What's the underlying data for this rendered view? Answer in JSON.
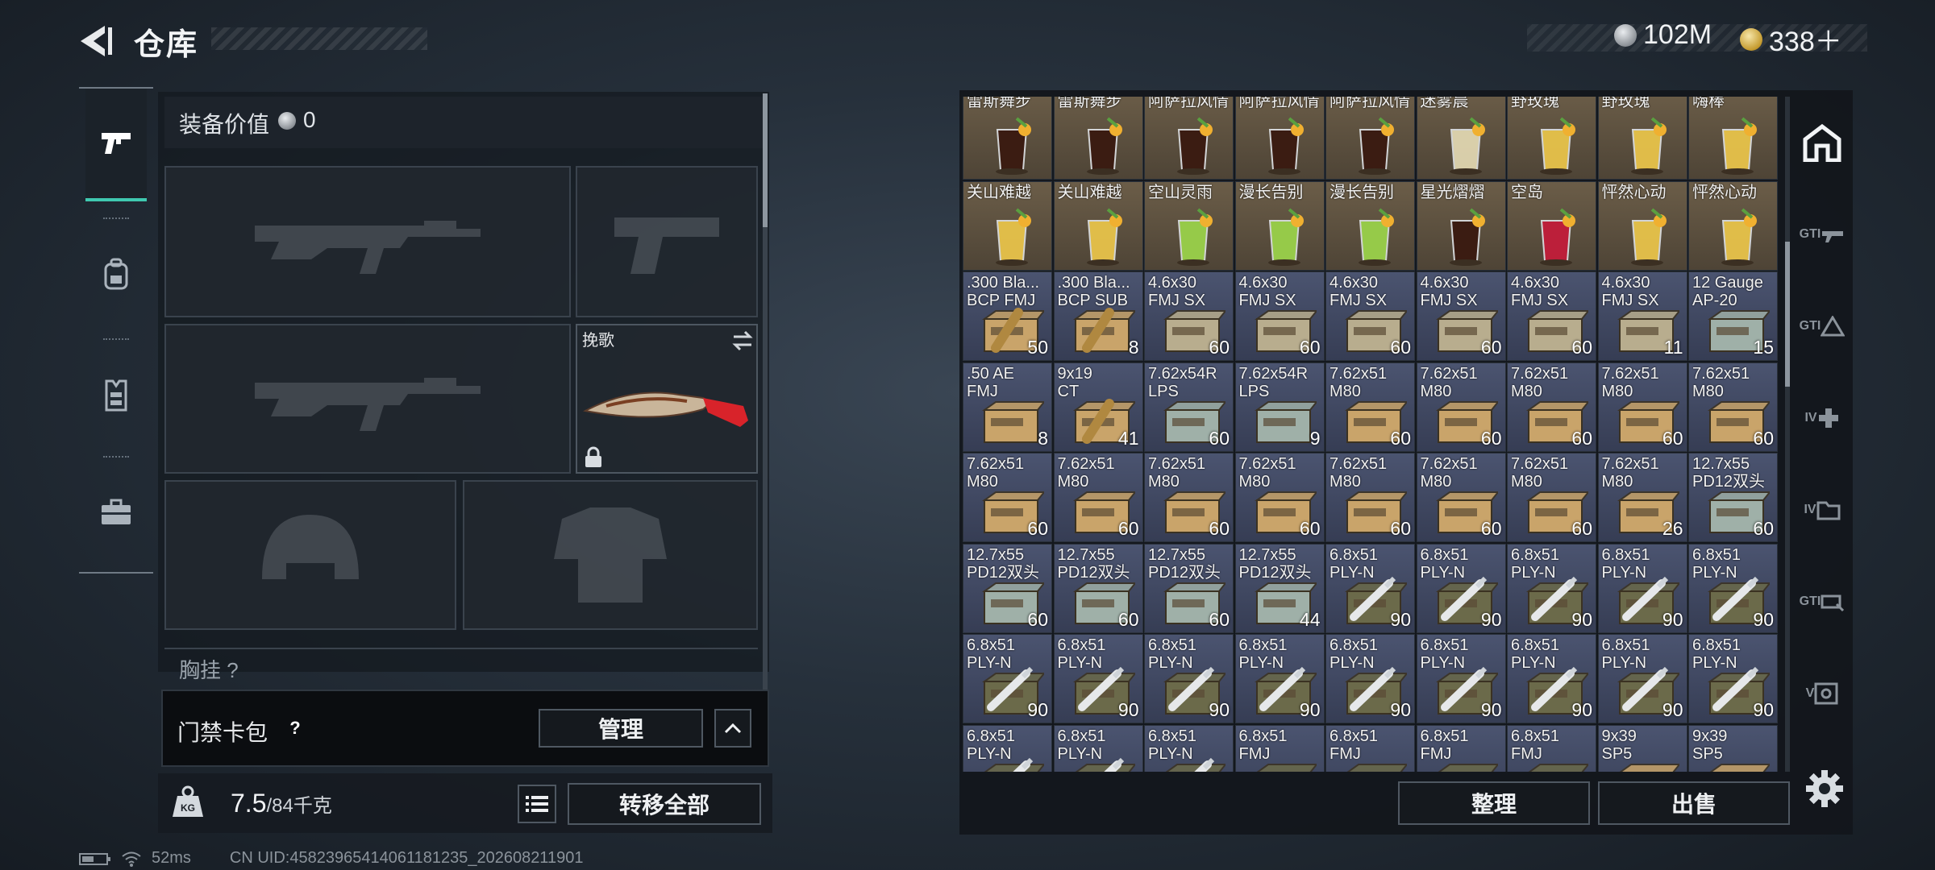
{
  "header": {
    "title": "仓库",
    "currency": [
      {
        "icon": "silver-coin-icon",
        "value": "102M"
      },
      {
        "icon": "gold-coin-icon",
        "value": "338＋"
      }
    ]
  },
  "left_nav": {
    "items": [
      {
        "name": "weapons",
        "icon": "pistol-icon",
        "active": true
      },
      {
        "name": "backpack",
        "icon": "backpack-icon",
        "active": false
      },
      {
        "name": "vest",
        "icon": "vest-icon",
        "active": false
      },
      {
        "name": "case",
        "icon": "briefcase-icon",
        "active": false
      }
    ]
  },
  "loadout": {
    "equip_value_label": "装备价值",
    "equip_value": "0",
    "secondary_slot_item": "挽歌",
    "chest_label": "胸挂 ?",
    "access_card_label": "门禁卡包",
    "access_help": "?",
    "manage_label": "管理",
    "weight_value": "7.5",
    "weight_cap": "/84千克",
    "weight_icon_text": "KG",
    "transfer_all_label": "转移全部"
  },
  "status": {
    "ping": "52ms",
    "uid": "CN UID:4582396541406118123​5_202608211901"
  },
  "inventory": {
    "cells": [
      [
        "雷斯舞步",
        "",
        "drink"
      ],
      [
        "雷斯舞步",
        "",
        "drink"
      ],
      [
        "阿萨拉风情",
        "",
        "drink"
      ],
      [
        "阿萨拉风情",
        "",
        "drink"
      ],
      [
        "阿萨拉风情",
        "",
        "drink"
      ],
      [
        "迷雾晨",
        "",
        "drink"
      ],
      [
        "野玫瑰",
        "",
        "drink"
      ],
      [
        "野玫瑰",
        "",
        "drink"
      ],
      [
        "嗨棒",
        "",
        "drink"
      ],
      [
        "关山难越",
        "",
        "drink"
      ],
      [
        "关山难越",
        "",
        "drink"
      ],
      [
        "空山灵雨",
        "",
        "drink"
      ],
      [
        "漫长告别",
        "",
        "drink"
      ],
      [
        "漫长告别",
        "",
        "drink"
      ],
      [
        "星光熠熠",
        "",
        "drink"
      ],
      [
        "空岛",
        "",
        "drink"
      ],
      [
        "怦然心动",
        "",
        "drink"
      ],
      [
        "怦然心动",
        "",
        "drink"
      ],
      [
        ".300 Bla...\nBCP FMJ",
        "50",
        "ammo"
      ],
      [
        ".300 Bla...\nBCP SUB",
        "8",
        "ammo"
      ],
      [
        "4.6x30\nFMJ SX",
        "60",
        "ammo"
      ],
      [
        "4.6x30\nFMJ SX",
        "60",
        "ammo"
      ],
      [
        "4.6x30\nFMJ SX",
        "60",
        "ammo"
      ],
      [
        "4.6x30\nFMJ SX",
        "60",
        "ammo"
      ],
      [
        "4.6x30\nFMJ SX",
        "60",
        "ammo"
      ],
      [
        "4.6x30\nFMJ SX",
        "11",
        "ammo"
      ],
      [
        "12 Gauge\nAP-20",
        "15",
        "ammo"
      ],
      [
        ".50 AE\nFMJ",
        "8",
        "ammo"
      ],
      [
        "9x19\nCT",
        "41",
        "ammo"
      ],
      [
        "7.62x54R\nLPS",
        "60",
        "ammo"
      ],
      [
        "7.62x54R\nLPS",
        "9",
        "ammo"
      ],
      [
        "7.62x51\nM80",
        "60",
        "ammo"
      ],
      [
        "7.62x51\nM80",
        "60",
        "ammo"
      ],
      [
        "7.62x51\nM80",
        "60",
        "ammo"
      ],
      [
        "7.62x51\nM80",
        "60",
        "ammo"
      ],
      [
        "7.62x51\nM80",
        "60",
        "ammo"
      ],
      [
        "7.62x51\nM80",
        "60",
        "ammo"
      ],
      [
        "7.62x51\nM80",
        "60",
        "ammo"
      ],
      [
        "7.62x51\nM80",
        "60",
        "ammo"
      ],
      [
        "7.62x51\nM80",
        "60",
        "ammo"
      ],
      [
        "7.62x51\nM80",
        "60",
        "ammo"
      ],
      [
        "7.62x51\nM80",
        "60",
        "ammo"
      ],
      [
        "7.62x51\nM80",
        "60",
        "ammo"
      ],
      [
        "7.62x51\nM80",
        "26",
        "ammo"
      ],
      [
        "12.7x55\nPD12双头",
        "60",
        "ammo"
      ],
      [
        "12.7x55\nPD12双头",
        "60",
        "ammo"
      ],
      [
        "12.7x55\nPD12双头",
        "60",
        "ammo"
      ],
      [
        "12.7x55\nPD12双头",
        "60",
        "ammo"
      ],
      [
        "12.7x55\nPD12双头",
        "44",
        "ammo"
      ],
      [
        "6.8x51\nPLY-N",
        "90",
        "ammo"
      ],
      [
        "6.8x51\nPLY-N",
        "90",
        "ammo"
      ],
      [
        "6.8x51\nPLY-N",
        "90",
        "ammo"
      ],
      [
        "6.8x51\nPLY-N",
        "90",
        "ammo"
      ],
      [
        "6.8x51\nPLY-N",
        "90",
        "ammo"
      ],
      [
        "6.8x51\nPLY-N",
        "90",
        "ammo"
      ],
      [
        "6.8x51\nPLY-N",
        "90",
        "ammo"
      ],
      [
        "6.8x51\nPLY-N",
        "90",
        "ammo"
      ],
      [
        "6.8x51\nPLY-N",
        "90",
        "ammo"
      ],
      [
        "6.8x51\nPLY-N",
        "90",
        "ammo"
      ],
      [
        "6.8x51\nPLY-N",
        "90",
        "ammo"
      ],
      [
        "6.8x51\nPLY-N",
        "90",
        "ammo"
      ],
      [
        "6.8x51\nPLY-N",
        "90",
        "ammo"
      ],
      [
        "6.8x51\nPLY-N",
        "90",
        "ammo"
      ],
      [
        "6.8x51\nPLY-N",
        "",
        "ammo"
      ],
      [
        "6.8x51\nPLY-N",
        "",
        "ammo"
      ],
      [
        "6.8x51\nPLY-N",
        "",
        "ammo"
      ],
      [
        "6.8x51\nFMJ",
        "",
        "ammo"
      ],
      [
        "6.8x51\nFMJ",
        "",
        "ammo"
      ],
      [
        "6.8x51\nFMJ",
        "",
        "ammo"
      ],
      [
        "6.8x51\nFMJ",
        "",
        "ammo"
      ],
      [
        "9x39\nSP5",
        "",
        "ammo"
      ],
      [
        "9x39\nSP5",
        "",
        "ammo"
      ]
    ],
    "sort_label": "整理",
    "sell_label": "出售"
  },
  "right_tabs": [
    {
      "name": "home",
      "label": ""
    },
    {
      "name": "gti-weapon",
      "label": "GTI"
    },
    {
      "name": "gti-warning",
      "label": "GTI"
    },
    {
      "name": "iv-medical",
      "label": "IV"
    },
    {
      "name": "iv-storage",
      "label": "IV"
    },
    {
      "name": "gti-tools",
      "label": "GTI"
    },
    {
      "name": "v-safe",
      "label": "V"
    }
  ],
  "colors": {
    "accent": "#3fc9b0",
    "drink_cell": "#5e5240",
    "ammo_cell": "#434b63",
    "lock_red": "#d8232a"
  }
}
